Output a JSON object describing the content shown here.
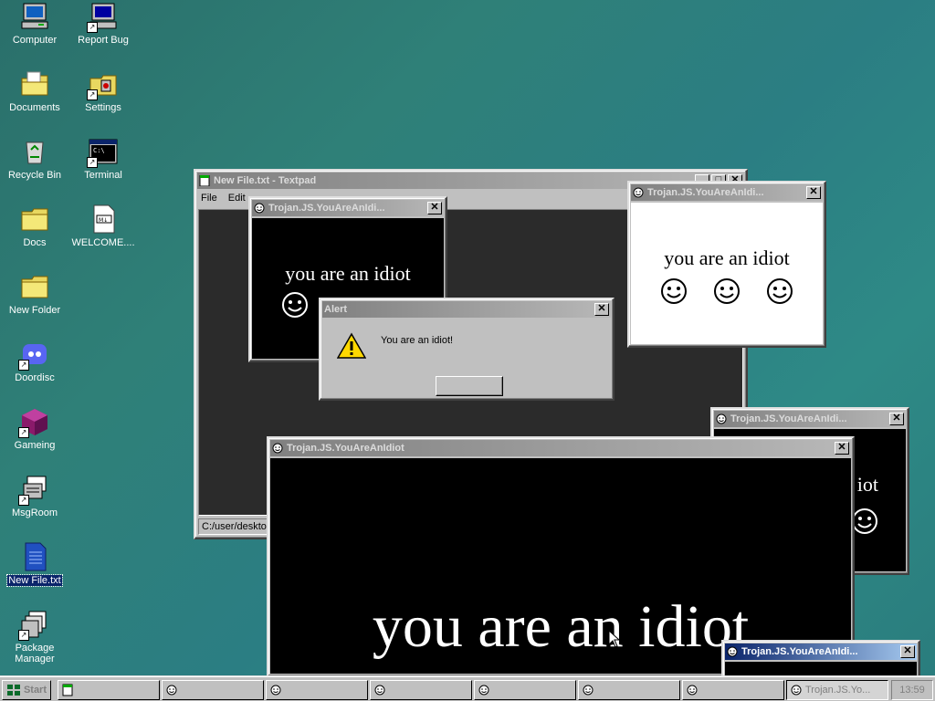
{
  "desktop": {
    "icons": [
      {
        "label": "Computer",
        "icon": "computer-icon"
      },
      {
        "label": "Report Bug",
        "icon": "report-bug-icon"
      },
      {
        "label": "Documents",
        "icon": "documents-folder-icon"
      },
      {
        "label": "Settings",
        "icon": "settings-icon"
      },
      {
        "label": "Recycle Bin",
        "icon": "recycle-bin-icon"
      },
      {
        "label": "Terminal",
        "icon": "terminal-icon"
      },
      {
        "label": "Docs",
        "icon": "folder-icon"
      },
      {
        "label": "WELCOME....",
        "icon": "markdown-file-icon"
      },
      {
        "label": "New Folder",
        "icon": "folder-icon"
      },
      {
        "label": "Doordisc",
        "icon": "doordisc-icon"
      },
      {
        "label": "Gameing",
        "icon": "cube-icon"
      },
      {
        "label": "MsgRoom",
        "icon": "msgroom-icon"
      },
      {
        "label": "New File.txt",
        "icon": "text-file-icon"
      },
      {
        "label": "Package Manager",
        "icon": "package-manager-icon"
      }
    ]
  },
  "textpad": {
    "title": "New File.txt - Textpad",
    "menu": [
      "File",
      "Edit"
    ],
    "status": "C:/user/desktop"
  },
  "popups": {
    "title": "Trojan.JS.YouAreAnIdiot",
    "small_title": "Trojan.JS.YouAreAnIdi...",
    "message": "you are an idiot",
    "partial_message": "iot"
  },
  "alert": {
    "title": "Alert",
    "message": "You are an idiot!",
    "ok_label": ""
  },
  "taskbar": {
    "start_label": "Start",
    "active_label": "Trojan.JS.Yo...",
    "clock": "13:59"
  },
  "colors": {
    "titlebar_active": "#0a246a",
    "titlebar_inactive": "#808080",
    "desktop": "#2f8078"
  }
}
